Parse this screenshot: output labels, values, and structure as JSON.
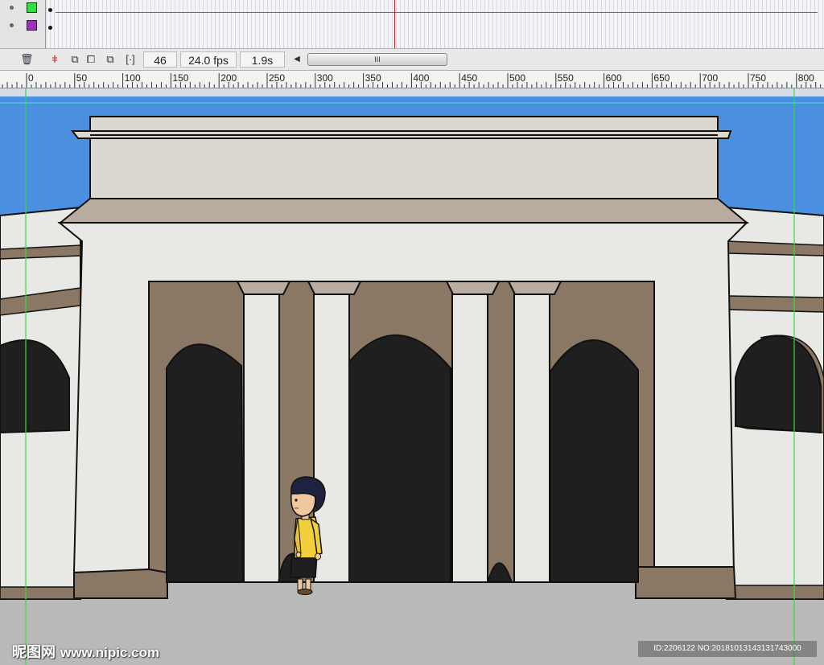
{
  "timeline": {
    "layers": [
      {
        "name_hint": "layer-green",
        "color": "#33dd44"
      },
      {
        "name_hint": "layer-purple",
        "color": "#9933bb"
      }
    ],
    "playhead_color": "#cc2222"
  },
  "toolbar": {
    "icons": [
      "trash-icon",
      "onion-center-icon",
      "onion-skin-icon",
      "onion-outline-icon",
      "edit-multiple-icon",
      "modify-markers-icon"
    ],
    "current_frame": "46",
    "frame_rate": "24.0 fps",
    "elapsed_time": "1.9s",
    "scroll_grip": "III"
  },
  "ruler": {
    "labels": [
      "0",
      "50",
      "100",
      "150",
      "200",
      "250",
      "300",
      "350",
      "400",
      "450",
      "500",
      "550",
      "600",
      "650",
      "700",
      "750",
      "800"
    ]
  },
  "stage": {
    "sky_color": "#4a8fe0",
    "ground_color": "#b9b9b9",
    "wall_color": "#e8e9e5",
    "trim_color": "#8a7764",
    "arch_color": "#1f1f1f",
    "guide_color": "#33dd44"
  },
  "watermark": {
    "brand": "昵图网",
    "url": "www.nipic.com",
    "id_text": "ID:2206122 NO:20181013143131743000"
  }
}
